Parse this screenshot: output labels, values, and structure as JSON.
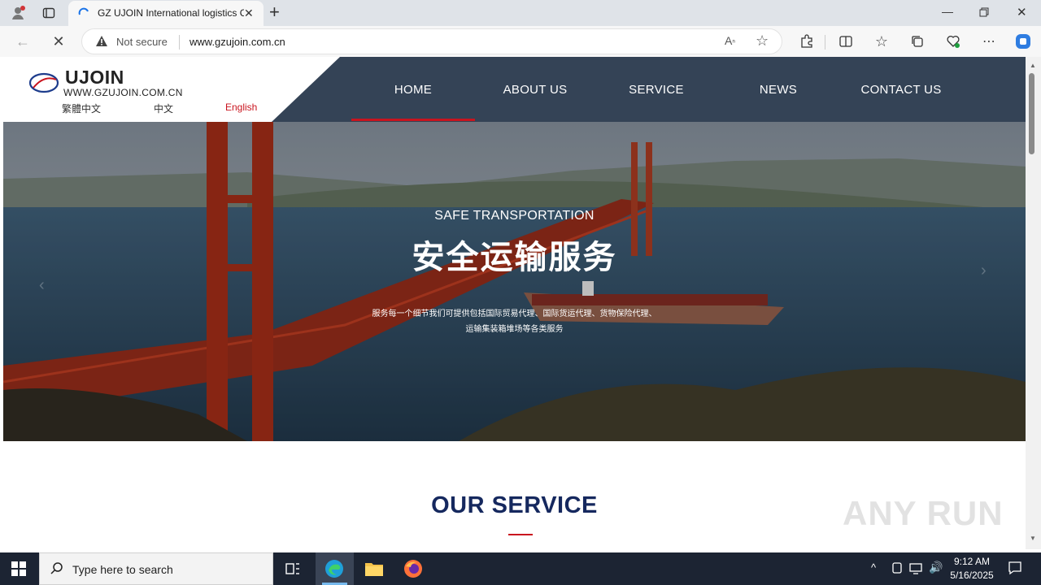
{
  "browser": {
    "tab_title": "GZ UJOIN International logistics Co",
    "new_tab": "+",
    "security_label": "Not secure",
    "url": "www.gzujoin.com.cn"
  },
  "site": {
    "logo_name": "UJOIN",
    "logo_domain": "WWW.GZUJOIN.COM.CN",
    "languages": [
      "繁體中文",
      "中文",
      "English"
    ],
    "nav": [
      "HOME",
      "ABOUT US",
      "SERVICE",
      "NEWS",
      "CONTACT US"
    ],
    "active_nav": "HOME"
  },
  "hero": {
    "eyebrow": "SAFE TRANSPORTATION",
    "headline": "安全运输服务",
    "desc_line1": "服务每一个细节我们可提供包括国际贸易代理、国际货运代理、货物保险代理、",
    "desc_line2": "运输集装箱堆场等各类服务"
  },
  "section": {
    "title": "OUR SERVICE"
  },
  "watermark": "ANY RUN",
  "taskbar": {
    "search_placeholder": "Type here to search",
    "time": "9:12 AM",
    "date": "5/16/2025"
  },
  "colors": {
    "nav_bg": "#344356",
    "accent": "#c9141e",
    "title_navy": "#15285e"
  }
}
